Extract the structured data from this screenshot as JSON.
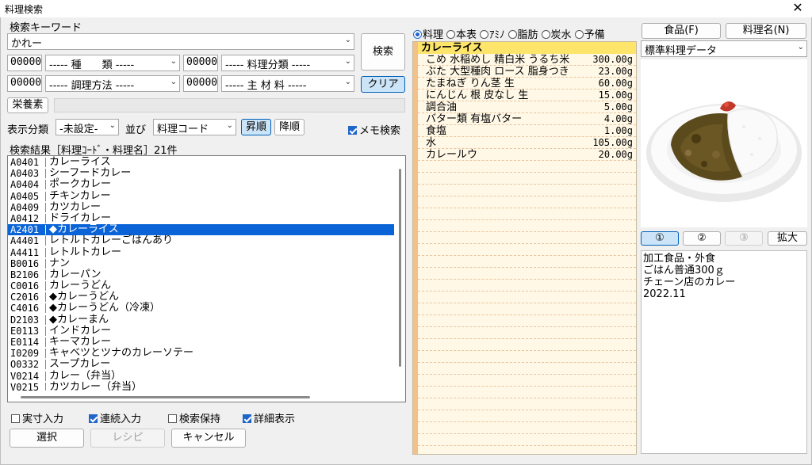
{
  "window": {
    "title": "料理検索",
    "close_glyph": "✕"
  },
  "search": {
    "keyword_label": "検索キーワード",
    "keyword_value": "かれー",
    "search_button": "検索",
    "clear_button": "クリア",
    "nutrient_button": "栄養素",
    "filters": [
      {
        "code": "00000",
        "label": "----- 種　　類 -----"
      },
      {
        "code": "00000",
        "label": "----- 料理分類 -----"
      },
      {
        "code": "00000",
        "label": "----- 調理方法 -----"
      },
      {
        "code": "00000",
        "label": "----- 主 材 料 -----"
      }
    ],
    "display_class_label": "表示分類",
    "display_class_value": "-未設定-",
    "sort_label": "並び",
    "sort_value": "料理コード",
    "asc_button": "昇順",
    "desc_button": "降順",
    "memo_search_label": "メモ検索"
  },
  "results": {
    "header": "検索結果［料理ｺｰﾄﾞ・料理名］21件",
    "items": [
      {
        "code": "A0401",
        "name": "カレーライス"
      },
      {
        "code": "A0403",
        "name": "シーフードカレー"
      },
      {
        "code": "A0404",
        "name": "ポークカレー"
      },
      {
        "code": "A0405",
        "name": "チキンカレー"
      },
      {
        "code": "A0409",
        "name": "カツカレー"
      },
      {
        "code": "A0412",
        "name": "ドライカレー"
      },
      {
        "code": "A2401",
        "name": "◆カレーライス"
      },
      {
        "code": "A4401",
        "name": "レトルトカレーごはんあり"
      },
      {
        "code": "A4411",
        "name": "レトルトカレー"
      },
      {
        "code": "B0016",
        "name": "ナン"
      },
      {
        "code": "B2106",
        "name": "カレーパン"
      },
      {
        "code": "C0016",
        "name": "カレーうどん"
      },
      {
        "code": "C2016",
        "name": "◆カレーうどん"
      },
      {
        "code": "C4016",
        "name": "◆カレーうどん（冷凍）"
      },
      {
        "code": "D2103",
        "name": "◆カレーまん"
      },
      {
        "code": "E0113",
        "name": "インドカレー"
      },
      {
        "code": "E0114",
        "name": "キーマカレー"
      },
      {
        "code": "I0209",
        "name": "キャベツとツナのカレーソテー"
      },
      {
        "code": "O0332",
        "name": "スープカレー"
      },
      {
        "code": "V0214",
        "name": "カレー（弁当）"
      },
      {
        "code": "V0215",
        "name": "カツカレー（弁当）"
      }
    ],
    "selected_index": 6
  },
  "options": {
    "actual_input": "実寸入力",
    "continuous_input": "連続入力",
    "keep_search": "検索保持",
    "detail_display": "詳細表示"
  },
  "actions": {
    "select": "選択",
    "recipe": "レシピ",
    "cancel": "キャンセル"
  },
  "view_tabs": [
    "料理",
    "本表",
    "ｱﾐﾉ",
    "脂肪",
    "炭水",
    "予備"
  ],
  "recipe": {
    "title": "カレーライス",
    "ingredients": [
      {
        "name": "こめ 水稲めし 精白米 うるち米",
        "amount": "300.00g"
      },
      {
        "name": "ぶた 大型種肉 ロース 脂身つき",
        "amount": "23.00g"
      },
      {
        "name": "たまねぎ りん茎 生",
        "amount": "60.00g"
      },
      {
        "name": "にんじん 根 皮なし 生",
        "amount": "15.00g"
      },
      {
        "name": "調合油",
        "amount": "5.00g"
      },
      {
        "name": "バター類 有塩バター",
        "amount": "4.00g"
      },
      {
        "name": "食塩",
        "amount": "1.00g"
      },
      {
        "name": "水",
        "amount": "105.00g"
      },
      {
        "name": "カレールウ",
        "amount": "20.00g"
      }
    ]
  },
  "right": {
    "food_button": "食品(F)",
    "dish_name_button": "料理名(N)",
    "data_source": "標準料理データ",
    "photo_buttons": [
      "①",
      "②",
      "③"
    ],
    "zoom_button": "拡大",
    "notes": [
      "加工食品・外食",
      "ごはん普通300ｇ",
      "チェーン店のカレー",
      "2022.11"
    ]
  },
  "colors": {
    "selection": "#0a64d7",
    "accent": "#1f66c8",
    "recipe_header": "#fde46a",
    "recipe_bg": "#fff8e6"
  }
}
